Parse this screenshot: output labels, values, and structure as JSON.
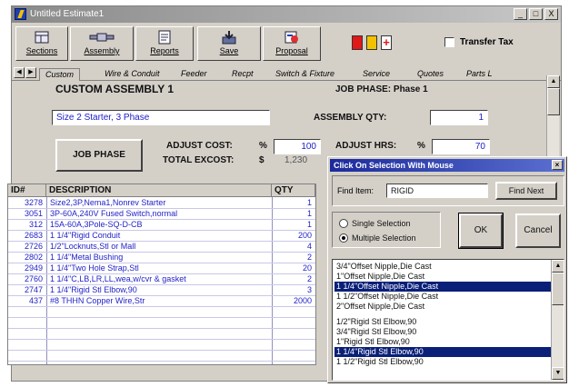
{
  "window": {
    "title": "Untitled Estimate1",
    "buttons": [
      "_",
      "□",
      "X"
    ]
  },
  "toolbar": {
    "buttons": [
      {
        "label": "Sections",
        "icon": "sections-icon"
      },
      {
        "label": "Assembly",
        "icon": "assembly-icon"
      },
      {
        "label": "Reports",
        "icon": "reports-icon"
      },
      {
        "label": "Save",
        "icon": "save-icon"
      },
      {
        "label": "Proposal",
        "icon": "proposal-icon"
      }
    ],
    "colored_squares": [
      "#e01818",
      "#f2c200",
      "#e01818"
    ],
    "transfer_tax_label": "Transfer Tax"
  },
  "tabs": [
    "Custom",
    "Wire & Conduit",
    "Feeder",
    "Recpt",
    "Switch & Fixture",
    "Service",
    "Quotes",
    "Parts L"
  ],
  "assembly": {
    "heading": "CUSTOM ASSEMBLY 1",
    "job_phase_label": "JOB PHASE: Phase 1",
    "name_value": "Size 2 Starter, 3 Phase",
    "qty_label": "ASSEMBLY QTY:",
    "qty_value": "1",
    "job_phase_button": "JOB PHASE",
    "adjust_cost_label": "ADJUST COST:",
    "pct_sign": "%",
    "adjust_cost_value": "100",
    "adjust_hrs_label": "ADJUST HRS:",
    "pct_sign2": "%",
    "adjust_hrs_value": "70",
    "total_excost_label": "TOTAL EXCOST:",
    "dollar_sign": "$",
    "total_excost_value": "1,230"
  },
  "grid": {
    "headers": [
      "ID#",
      "DESCRIPTION",
      "QTY"
    ],
    "rows": [
      {
        "id": "3278",
        "desc": "Size2,3P,Nema1,Nonrev Starter",
        "qty": "1"
      },
      {
        "id": "3051",
        "desc": "3P-60A,240V Fused Switch,normal",
        "qty": "1"
      },
      {
        "id": "312",
        "desc": "15A-60A,3Pole-SQ-D-CB",
        "qty": "1"
      },
      {
        "id": "2683",
        "desc": "1 1/4\"Rigid Conduit",
        "qty": "200"
      },
      {
        "id": "2726",
        "desc": "1/2\"Locknuts,Stl or Mall",
        "qty": "4"
      },
      {
        "id": "2802",
        "desc": "1 1/4\"Metal Bushing",
        "qty": "2"
      },
      {
        "id": "2949",
        "desc": "1 1/4\"Two Hole Strap,Stl",
        "qty": "20"
      },
      {
        "id": "2760",
        "desc": "1 1/4\"C,LB,LR,LL,wea,w/cvr & gasket",
        "qty": "2"
      },
      {
        "id": "2747",
        "desc": "1 1/4\"Rigid Stl Elbow,90",
        "qty": "3"
      },
      {
        "id": "437",
        "desc": "#8 THHN Copper Wire,Str",
        "qty": "2000"
      }
    ]
  },
  "dialog": {
    "title": "Click On Selection With Mouse",
    "find_label": "Find Item:",
    "find_value": "RIGID",
    "find_next": "Find Next",
    "single_label": "Single Selection",
    "multiple_label": "Multiple Selection",
    "ok": "OK",
    "cancel": "Cancel",
    "items": [
      {
        "text": "3/4\"Offset Nipple,Die Cast",
        "selected": false
      },
      {
        "text": "1\"Offset Nipple,Die Cast",
        "selected": false
      },
      {
        "text": "1 1/4\"Offset Nipple,Die Cast",
        "selected": true
      },
      {
        "text": "1 1/2\"Offset Nipple,Die Cast",
        "selected": false
      },
      {
        "text": "2\"Offset Nipple,Die Cast",
        "selected": false
      },
      {
        "text": "",
        "selected": false
      },
      {
        "text": "1/2\"Rigid Stl Elbow,90",
        "selected": false
      },
      {
        "text": "3/4\"Rigid Stl Elbow,90",
        "selected": false
      },
      {
        "text": "1\"Rigid Stl Elbow,90",
        "selected": false
      },
      {
        "text": "1 1/4\"Rigid Stl Elbow,90",
        "selected": true
      },
      {
        "text": "1 1/2\"Rigid Stl Elbow,90",
        "selected": false
      }
    ]
  }
}
